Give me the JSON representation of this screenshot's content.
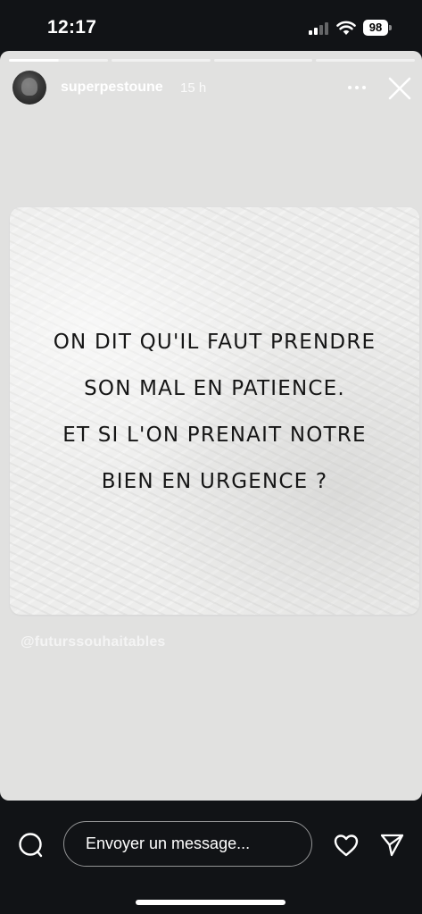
{
  "status_bar": {
    "time": "12:17",
    "battery": "98",
    "icons": [
      "signal-icon",
      "wifi-icon",
      "battery-icon"
    ]
  },
  "story": {
    "progress": {
      "segments": 4,
      "active_index": 0,
      "active_fill": 0.5
    },
    "username": "superpestoune",
    "time_ago": "15 h",
    "icons": [
      "avatar",
      "more-options-icon",
      "close-icon"
    ],
    "quote_lines": [
      "ON DIT QU'IL FAUT PRENDRE",
      "SON MAL EN PATIENCE.",
      "ET SI L'ON PRENAIT NOTRE",
      "BIEN EN URGENCE ?"
    ],
    "watermark": "@futurssouhaitables"
  },
  "bottom_bar": {
    "message_placeholder": "Envoyer un message...",
    "icons": [
      "camera-icon",
      "heart-icon",
      "send-icon"
    ]
  },
  "colors": {
    "background": "#111316",
    "story_background": "#e1e1e0",
    "card": "#ededec",
    "quote_text": "#151515"
  }
}
